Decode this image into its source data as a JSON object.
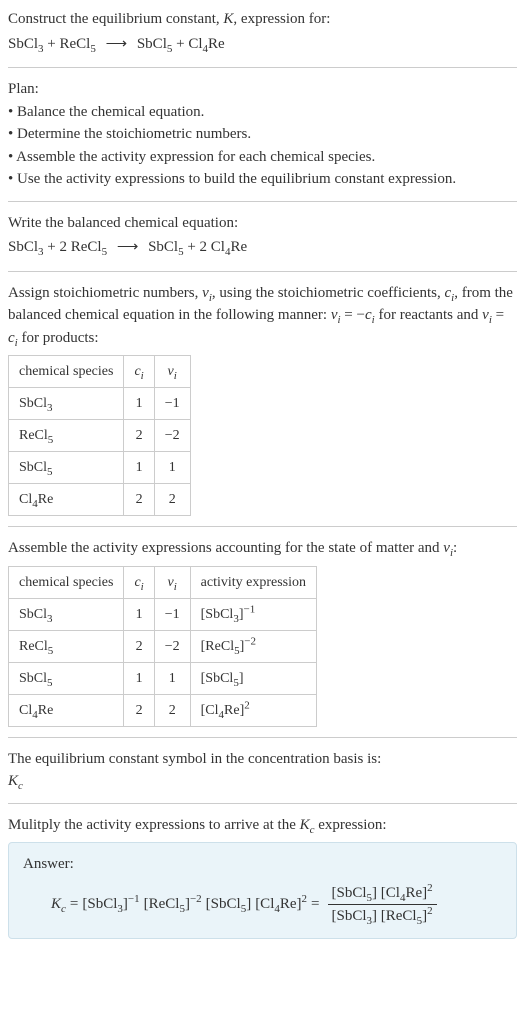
{
  "header": {
    "prompt_line1": "Construct the equilibrium constant, ",
    "prompt_K": "K",
    "prompt_line1_end": ", expression for:",
    "equation_lhs_1": "SbCl",
    "equation_lhs_1_sub": "3",
    "plus": " + ",
    "equation_lhs_2": "ReCl",
    "equation_lhs_2_sub": "5",
    "arrow": "⟶",
    "equation_rhs_1": "SbCl",
    "equation_rhs_1_sub": "5",
    "equation_rhs_2": "Cl",
    "equation_rhs_2_sub": "4",
    "equation_rhs_2b": "Re"
  },
  "plan": {
    "title": "Plan:",
    "b1": "• Balance the chemical equation.",
    "b2": "• Determine the stoichiometric numbers.",
    "b3": "• Assemble the activity expression for each chemical species.",
    "b4": "• Use the activity expressions to build the equilibrium constant expression."
  },
  "balanced": {
    "intro": "Write the balanced chemical equation:",
    "lhs1": "SbCl",
    "lhs1_sub": "3",
    "plus1": " + 2 ReCl",
    "lhs2_sub": "5",
    "arrow": "⟶",
    "rhs1": "SbCl",
    "rhs1_sub": "5",
    "plus2": " + 2 Cl",
    "rhs2_sub": "4",
    "rhs2b": "Re"
  },
  "stoich": {
    "intro_a": "Assign stoichiometric numbers, ",
    "nu": "ν",
    "i": "i",
    "intro_b": ", using the stoichiometric coefficients, ",
    "c": "c",
    "intro_c": ", from the balanced chemical equation in the following manner: ",
    "rel1a": "ν",
    "rel1b": " = −",
    "rel1c": "c",
    "intro_d": " for reactants and ",
    "rel2a": "ν",
    "rel2b": " = ",
    "rel2c": "c",
    "intro_e": " for products:",
    "table": {
      "h1": "chemical species",
      "h2": "c",
      "h2sub": "i",
      "h3": "ν",
      "h3sub": "i",
      "rows": [
        {
          "sp_a": "SbCl",
          "sp_sub": "3",
          "c": "1",
          "nu": "−1"
        },
        {
          "sp_a": "ReCl",
          "sp_sub": "5",
          "c": "2",
          "nu": "−2"
        },
        {
          "sp_a": "SbCl",
          "sp_sub": "5",
          "c": "1",
          "nu": "1"
        },
        {
          "sp_a": "Cl",
          "sp_sub": "4",
          "sp_b": "Re",
          "c": "2",
          "nu": "2"
        }
      ]
    }
  },
  "activity": {
    "intro_a": "Assemble the activity expressions accounting for the state of matter and ",
    "nu": "ν",
    "i": "i",
    "intro_b": ":",
    "table": {
      "h1": "chemical species",
      "h2": "c",
      "h2sub": "i",
      "h3": "ν",
      "h3sub": "i",
      "h4": "activity expression",
      "rows": [
        {
          "sp_a": "SbCl",
          "sp_sub": "3",
          "c": "1",
          "nu": "−1",
          "ae_a": "[SbCl",
          "ae_sub": "3",
          "ae_b": "]",
          "ae_sup": "−1"
        },
        {
          "sp_a": "ReCl",
          "sp_sub": "5",
          "c": "2",
          "nu": "−2",
          "ae_a": "[ReCl",
          "ae_sub": "5",
          "ae_b": "]",
          "ae_sup": "−2"
        },
        {
          "sp_a": "SbCl",
          "sp_sub": "5",
          "c": "1",
          "nu": "1",
          "ae_a": "[SbCl",
          "ae_sub": "5",
          "ae_b": "]",
          "ae_sup": ""
        },
        {
          "sp_a": "Cl",
          "sp_sub": "4",
          "sp_b": "Re",
          "c": "2",
          "nu": "2",
          "ae_a": "[Cl",
          "ae_sub": "4",
          "ae_a2": "Re",
          "ae_b": "]",
          "ae_sup": "2"
        }
      ]
    }
  },
  "symbol": {
    "intro": "The equilibrium constant symbol in the concentration basis is:",
    "K": "K",
    "c": "c"
  },
  "final": {
    "intro_a": "Mulitply the activity expressions to arrive at the ",
    "K": "K",
    "c": "c",
    "intro_b": " expression:",
    "answer_label": "Answer:",
    "Kc": "K",
    "Kc_sub": "c",
    "eq": " = ",
    "term1_a": "[SbCl",
    "term1_sub": "3",
    "term1_b": "]",
    "term1_sup": "−1",
    "term2_a": "[ReCl",
    "term2_sub": "5",
    "term2_b": "]",
    "term2_sup": "−2",
    "term3_a": "[SbCl",
    "term3_sub": "5",
    "term3_b": "]",
    "term4_a": "[Cl",
    "term4_sub": "4",
    "term4_a2": "Re",
    "term4_b": "]",
    "term4_sup": "2",
    "eq2": " = ",
    "num1_a": "[SbCl",
    "num1_sub": "5",
    "num1_b": "] ",
    "num2_a": "[Cl",
    "num2_sub": "4",
    "num2_a2": "Re",
    "num2_b": "]",
    "num2_sup": "2",
    "den1_a": "[SbCl",
    "den1_sub": "3",
    "den1_b": "] ",
    "den2_a": "[ReCl",
    "den2_sub": "5",
    "den2_b": "]",
    "den2_sup": "2"
  },
  "chart_data": {
    "type": "table",
    "tables": [
      {
        "title": "Stoichiometric numbers",
        "columns": [
          "chemical species",
          "c_i",
          "ν_i"
        ],
        "rows": [
          [
            "SbCl3",
            1,
            -1
          ],
          [
            "ReCl5",
            2,
            -2
          ],
          [
            "SbCl5",
            1,
            1
          ],
          [
            "Cl4Re",
            2,
            2
          ]
        ]
      },
      {
        "title": "Activity expressions",
        "columns": [
          "chemical species",
          "c_i",
          "ν_i",
          "activity expression"
        ],
        "rows": [
          [
            "SbCl3",
            1,
            -1,
            "[SbCl3]^-1"
          ],
          [
            "ReCl5",
            2,
            -2,
            "[ReCl5]^-2"
          ],
          [
            "SbCl5",
            1,
            1,
            "[SbCl5]"
          ],
          [
            "Cl4Re",
            2,
            2,
            "[Cl4Re]^2"
          ]
        ]
      }
    ]
  }
}
